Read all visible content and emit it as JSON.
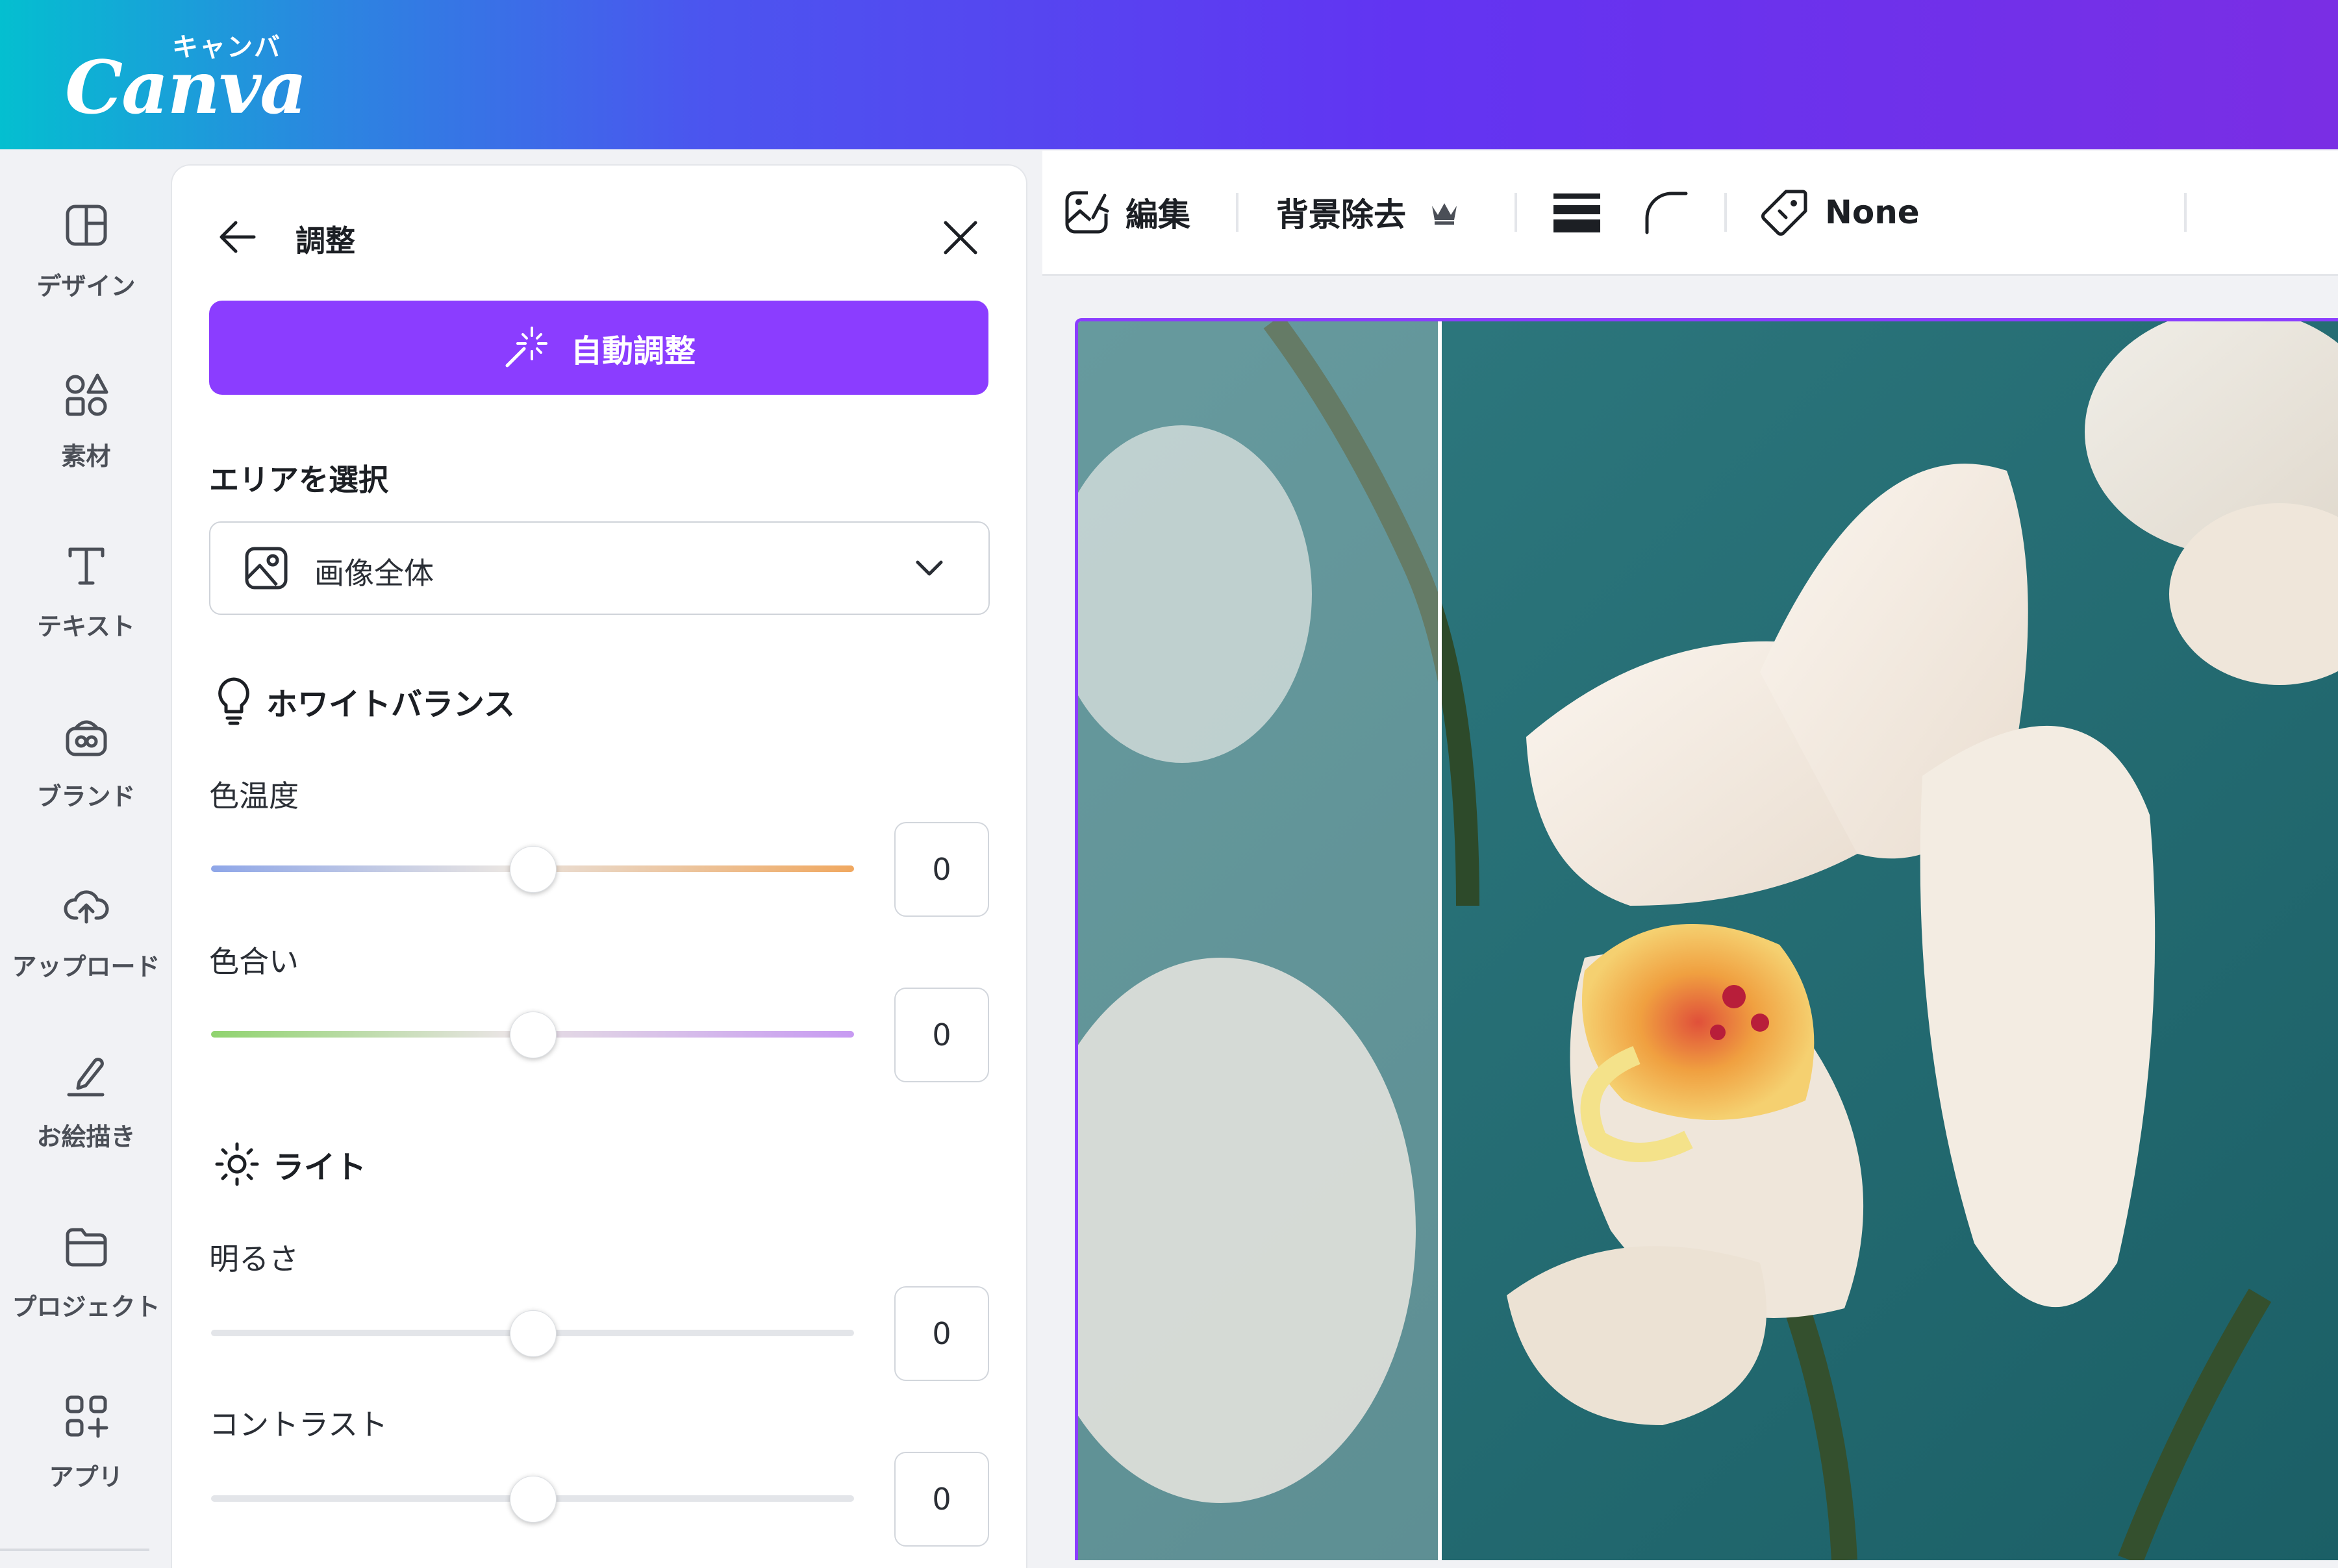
{
  "brand": {
    "kana": "キャンバ",
    "wordmark": "Canva"
  },
  "sidebar": {
    "items": [
      {
        "label": "デザイン",
        "icon": "design-layout-icon"
      },
      {
        "label": "素材",
        "icon": "elements-shapes-icon"
      },
      {
        "label": "テキスト",
        "icon": "text-T-icon"
      },
      {
        "label": "ブランド",
        "icon": "brand-icon"
      },
      {
        "label": "アップロード",
        "icon": "cloud-upload-icon"
      },
      {
        "label": "お絵描き",
        "icon": "draw-pen-icon"
      },
      {
        "label": "プロジェクト",
        "icon": "folder-icon"
      },
      {
        "label": "アプリ",
        "icon": "apps-grid-icon"
      }
    ]
  },
  "panel": {
    "title": "調整",
    "auto_adjust_label": "自動調整",
    "area_section_title": "エリアを選択",
    "area_select_value": "画像全体",
    "white_balance": {
      "title": "ホワイトバランス",
      "sliders": [
        {
          "label": "色温度",
          "value": "0",
          "level": 0.5
        },
        {
          "label": "色合い",
          "value": "0",
          "level": 0.5
        }
      ]
    },
    "light": {
      "title": "ライト",
      "sliders": [
        {
          "label": "明るさ",
          "value": "0",
          "level": 0.5
        },
        {
          "label": "コントラスト",
          "value": "0",
          "level": 0.5
        }
      ]
    }
  },
  "toolbar": {
    "edit_label": "編集",
    "bg_remove_label": "背景除去",
    "tag_label": "None"
  },
  "colors": {
    "accent": "#8b3dff",
    "temperature_left": "#8ea6e8",
    "temperature_right": "#f0a860",
    "tint_left": "#8fd36e",
    "tint_right": "#c79af2"
  }
}
